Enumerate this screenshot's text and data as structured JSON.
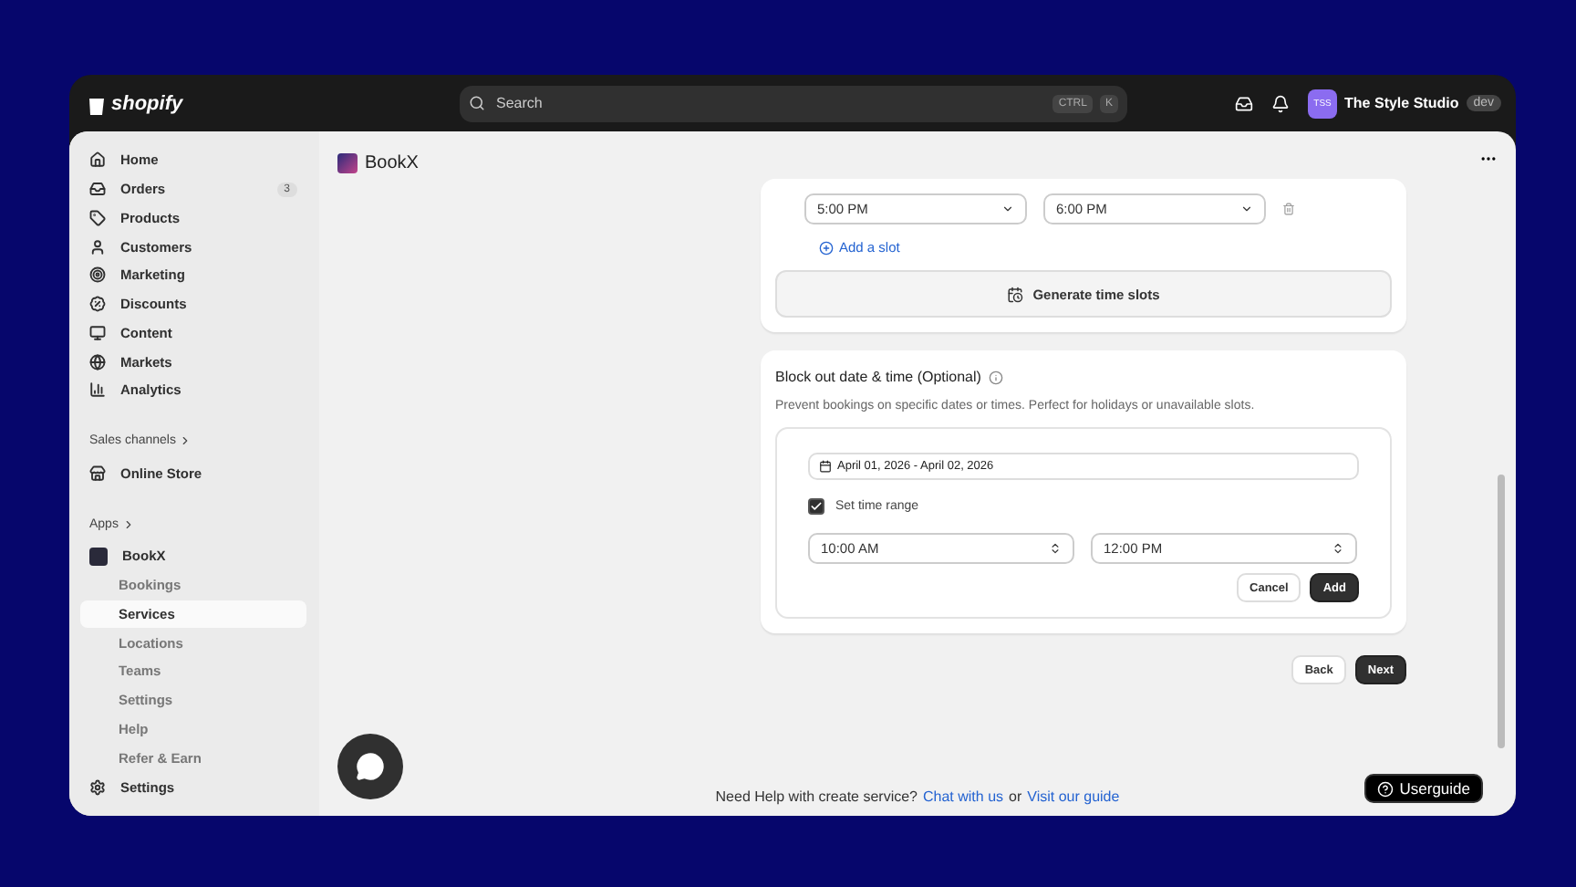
{
  "topbar": {
    "logo": "shopify",
    "search": {
      "placeholder": "Search"
    },
    "shortcut": [
      "CTRL",
      "K"
    ],
    "store": {
      "avatar": "TSS",
      "name": "The Style Studio",
      "badge": "dev"
    }
  },
  "sidebar": {
    "items": [
      {
        "label": "Home",
        "selected": false
      },
      {
        "label": "Orders",
        "badge": "3",
        "selected": false
      },
      {
        "label": "Products",
        "selected": false
      },
      {
        "label": "Customers",
        "selected": false
      },
      {
        "label": "Marketing",
        "selected": false
      },
      {
        "label": "Discounts",
        "selected": false
      },
      {
        "label": "Content",
        "selected": false
      },
      {
        "label": "Markets",
        "selected": false
      },
      {
        "label": "Analytics",
        "selected": false
      }
    ],
    "sales_channels": {
      "heading": "Sales channels",
      "items": [
        {
          "label": "Online Store"
        }
      ]
    },
    "apps": {
      "heading": "Apps",
      "app": {
        "label": "BookX",
        "children": [
          {
            "label": "Bookings",
            "selected": false
          },
          {
            "label": "Services",
            "selected": true
          },
          {
            "label": "Locations",
            "selected": false
          },
          {
            "label": "Teams",
            "selected": false
          },
          {
            "label": "Settings",
            "selected": false
          },
          {
            "label": "Help",
            "selected": false
          },
          {
            "label": "Refer & Earn",
            "selected": false
          }
        ]
      }
    },
    "footer": {
      "label": "Settings"
    }
  },
  "main": {
    "app_title": "BookX",
    "slots": {
      "rows": [
        {
          "start": "5:00 PM",
          "end": "6:00 PM"
        }
      ],
      "add_link": "Add a slot",
      "generate_button": "Generate time slots"
    },
    "block_out": {
      "title": "Block out date & time (Optional)",
      "description": "Prevent bookings on specific dates or times. Perfect for holidays or unavailable slots.",
      "date_range": "April 01, 2026 - April 02, 2026",
      "time_range": {
        "label": "Set time range",
        "checked": true
      },
      "from": "10:00 AM",
      "to": "12:00 PM",
      "cancel": "Cancel",
      "add": "Add"
    },
    "nav": {
      "back": "Back",
      "next": "Next"
    },
    "help": {
      "text": "Need Help with create service?",
      "link_1": "Chat with us",
      "joiner": "or",
      "link_2": "Visit our guide"
    },
    "userguide": "Userguide"
  }
}
